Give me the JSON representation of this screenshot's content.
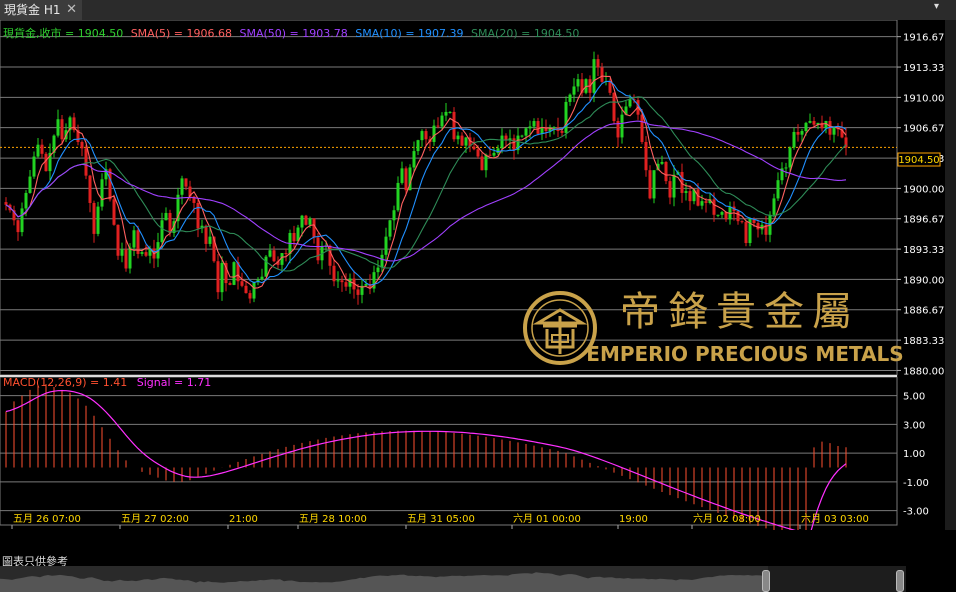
{
  "tab": {
    "title": "現貨金 H1",
    "close": "✕"
  },
  "legend": {
    "main": [
      {
        "text": "現貨金,收市 = 1904.50",
        "color": "#2fcf2f"
      },
      {
        "text": "SMA(5) = 1906.68",
        "color": "#ff6060"
      },
      {
        "text": "SMA(50) = 1903.78",
        "color": "#a040ff"
      },
      {
        "text": "SMA(10) = 1907.39",
        "color": "#2090ff"
      },
      {
        "text": "SMA(20) = 1904.50",
        "color": "#2e8b57"
      }
    ],
    "macd": [
      {
        "text": "MACD(12,26,9) = 1.41",
        "color": "#ff5030"
      },
      {
        "text": "Signal = 1.71",
        "color": "#ff30ff"
      }
    ]
  },
  "price_label": "1904.50",
  "watermark": {
    "chinese": "帝鋒貴金屬",
    "english": "EMPERIO PRECIOUS METALS"
  },
  "disclaimer": "圖表只供參考",
  "colors": {
    "up": "#22d322",
    "down": "#e02020",
    "sma5": "#ff6060",
    "sma10": "#2090ff",
    "sma20": "#2e8b57",
    "sma50": "#a040ff",
    "macd": "#ff5030",
    "signal": "#ff30ff",
    "grid": "#7a7a7a",
    "axis_text": "#ffffff",
    "time_text": "#ffd700",
    "price_line": "#ffa500",
    "gold": "#c9a24a"
  },
  "chart_data": [
    {
      "type": "candlestick",
      "title": "現貨金 H1",
      "price_axis": {
        "ticks": [
          1916.67,
          1913.33,
          1910.0,
          1906.67,
          1903.33,
          1900.0,
          1896.67,
          1893.33,
          1890.0,
          1886.67,
          1883.33,
          1880.0
        ],
        "ylim": [
          1879.5,
          1918.5
        ],
        "current": 1904.5
      },
      "time_labels": [
        "五月 26 07:00",
        "五月 27 02:00",
        "21:00",
        "五月 28 10:00",
        "五月 31 05:00",
        "六月 01 00:00",
        "19:00",
        "六月 02 08:00",
        "六月 03 03:00"
      ],
      "close": [
        1898.2,
        1897.6,
        1896.5,
        1895.2,
        1897.8,
        1899.5,
        1901.3,
        1903.5,
        1904.8,
        1903.8,
        1901.9,
        1903.9,
        1905.8,
        1907.6,
        1905.4,
        1906.4,
        1907.8,
        1906.4,
        1905.1,
        1904.4,
        1901.4,
        1898.4,
        1895.0,
        1898.0,
        1901.0,
        1902.1,
        1898.8,
        1896.0,
        1892.6,
        1893.3,
        1891.2,
        1893.5,
        1895.4,
        1892.8,
        1893.0,
        1892.6,
        1893.4,
        1892.3,
        1894.1,
        1896.5,
        1897.3,
        1895.1,
        1896.4,
        1899.3,
        1901.1,
        1900.2,
        1899.1,
        1898.4,
        1895.6,
        1895.9,
        1893.9,
        1894.7,
        1892.0,
        1888.6,
        1891.8,
        1889.6,
        1889.4,
        1891.9,
        1889.8,
        1889.3,
        1888.5,
        1887.9,
        1889.7,
        1890.0,
        1890.3,
        1892.5,
        1893.2,
        1892.0,
        1891.6,
        1892.9,
        1892.8,
        1895.1,
        1894.2,
        1895.7,
        1897.0,
        1896.0,
        1896.7,
        1894.6,
        1892.1,
        1893.6,
        1893.7,
        1891.5,
        1889.8,
        1889.9,
        1889.7,
        1889.2,
        1890.1,
        1888.9,
        1888.3,
        1889.3,
        1889.5,
        1889.0,
        1890.8,
        1891.3,
        1892.7,
        1894.7,
        1896.5,
        1897.6,
        1900.6,
        1902.2,
        1899.8,
        1902.3,
        1904.1,
        1905.3,
        1906.3,
        1905.4,
        1905.1,
        1906.9,
        1906.8,
        1908.0,
        1908.4,
        1908.4,
        1905.4,
        1905.8,
        1904.7,
        1905.6,
        1904.6,
        1904.3,
        1903.5,
        1902.0,
        1903.7,
        1903.6,
        1903.9,
        1904.4,
        1905.8,
        1905.3,
        1905.5,
        1904.2,
        1905.8,
        1905.8,
        1906.6,
        1906.8,
        1907.4,
        1906.0,
        1906.7,
        1906.3,
        1906.7,
        1906.7,
        1906.3,
        1906.1,
        1909.5,
        1910.3,
        1911.2,
        1912.0,
        1910.5,
        1912.0,
        1910.5,
        1914.2,
        1913.3,
        1911.7,
        1911.8,
        1910.5,
        1907.4,
        1905.6,
        1908.1,
        1909.0,
        1909.8,
        1909.7,
        1908.1,
        1905.1,
        1902.0,
        1898.9,
        1902.0,
        1902.7,
        1902.9,
        1900.8,
        1899.0,
        1901.5,
        1901.8,
        1899.5,
        1899.7,
        1898.6,
        1899.9,
        1898.1,
        1898.6,
        1898.4,
        1898.8,
        1897.1,
        1897.1,
        1897.4,
        1896.6,
        1898.0,
        1897.5,
        1896.4,
        1896.3,
        1894.0,
        1896.7,
        1896.2,
        1895.5,
        1896.0,
        1894.9,
        1897.1,
        1898.9,
        1900.9,
        1902.2,
        1902.3,
        1904.5,
        1906.2,
        1905.9,
        1906.3,
        1907.2,
        1907.4,
        1907.0,
        1907.2,
        1906.6,
        1907.4,
        1905.9,
        1906.7,
        1906.5,
        1905.6,
        1904.5
      ]
    },
    {
      "type": "bar+line",
      "title": "MACD(12,26,9) = 1.41  Signal = 1.71",
      "axis_ticks": [
        5.0,
        3.0,
        1.0,
        -1.0,
        -3.0
      ],
      "ylim": [
        -4.0,
        6.3
      ],
      "histogram_start": [
        3.9,
        4.3,
        4.6,
        4.8,
        5.0,
        5.2,
        5.4,
        5.6,
        5.7,
        5.8,
        5.8,
        5.7,
        5.6,
        5.5,
        5.4,
        5.3,
        5.2,
        5.0,
        4.8,
        4.6,
        4.3,
        4.0,
        3.6,
        3.2,
        2.8,
        2.4,
        2.0,
        1.6,
        1.2,
        0.8,
        0.5,
        0.2,
        0.0,
        -0.2,
        -0.3,
        -0.4,
        -0.5,
        -0.6,
        -0.7,
        -0.8,
        -0.9,
        -1.0,
        -1.0,
        -1.0,
        -1.0
      ],
      "histogram_end": [
        1.4,
        1.7,
        1.8,
        1.9,
        1.7,
        1.6,
        1.5,
        1.4,
        1.41
      ],
      "signal_end": [
        1.3,
        1.5,
        1.6,
        1.7,
        1.71
      ]
    }
  ]
}
